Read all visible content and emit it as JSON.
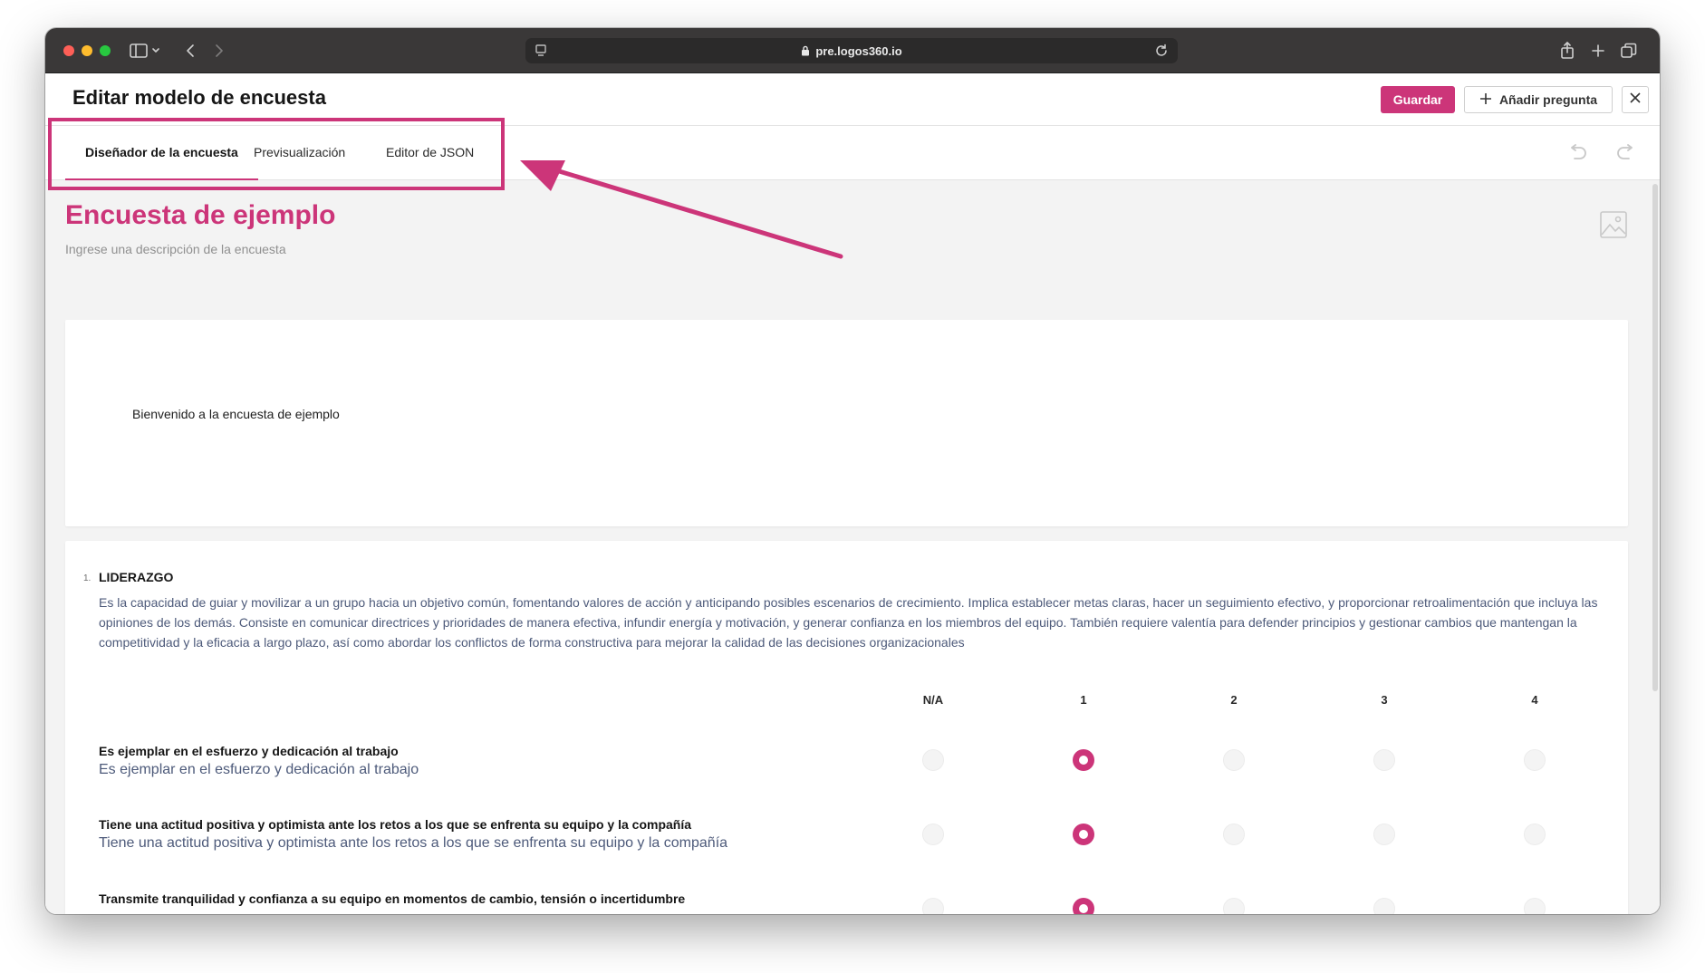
{
  "browser": {
    "url": "pre.logos360.io"
  },
  "header": {
    "title": "Editar modelo de encuesta",
    "save_label": "Guardar",
    "add_question_label": "Añadir pregunta"
  },
  "tabs": [
    {
      "label": "Diseñador de la encuesta",
      "active": true
    },
    {
      "label": "Previsualización",
      "active": false
    },
    {
      "label": "Editor de JSON",
      "active": false
    }
  ],
  "survey": {
    "title": "Encuesta de ejemplo",
    "description_placeholder": "Ingrese una descripción de la encuesta",
    "welcome_text": "Bienvenido a la encuesta de ejemplo"
  },
  "question": {
    "number": "1.",
    "title": "LIDERAZGO",
    "description": "Es la capacidad de guiar y movilizar a un grupo hacia un objetivo común, fomentando valores de acción y anticipando posibles escenarios de crecimiento. Implica establecer metas claras, hacer un seguimiento efectivo, y proporcionar retroalimentación que incluya las opiniones de los demás. Consiste en comunicar directrices y prioridades de manera efectiva, infundir energía y motivación, y generar confianza en los miembros del equipo. También requiere valentía para defender principios y gestionar cambios que mantengan la competitividad y la eficacia a largo plazo, así como abordar los conflictos de forma constructiva para mejorar la calidad de las decisiones organizacionales",
    "columns": [
      "N/A",
      "1",
      "2",
      "3",
      "4"
    ],
    "rows": [
      {
        "title": "Es ejemplar en el esfuerzo y dedicación al trabajo",
        "subtitle": "Es ejemplar en el esfuerzo y dedicación al trabajo",
        "selected_index": 1
      },
      {
        "title": "Tiene una actitud positiva y optimista ante los retos  a los que se enfrenta su equipo y  la compañía",
        "subtitle": "Tiene una actitud positiva y optimista ante los retos  a los que se enfrenta su equipo y  la compañía",
        "selected_index": 1
      },
      {
        "title": "Transmite tranquilidad y confianza a su equipo en momentos de cambio, tensión o incertidumbre",
        "subtitle": "",
        "selected_index": 1
      }
    ]
  },
  "icons": {
    "sidebar": "sidebar-icon",
    "back": "chevron-left-icon",
    "forward": "chevron-right-icon",
    "lock": "lock-icon",
    "reload": "reload-icon",
    "share": "share-icon",
    "new_tab": "plus-icon",
    "tabs": "tabs-icon",
    "close": "close-icon",
    "undo": "undo-icon",
    "redo": "redo-icon",
    "image": "image-icon"
  },
  "colors": {
    "accent": "#cc3579",
    "chrome": "#3a3838",
    "content_bg": "#f3f3f3",
    "description_text": "#4d5a7a"
  }
}
